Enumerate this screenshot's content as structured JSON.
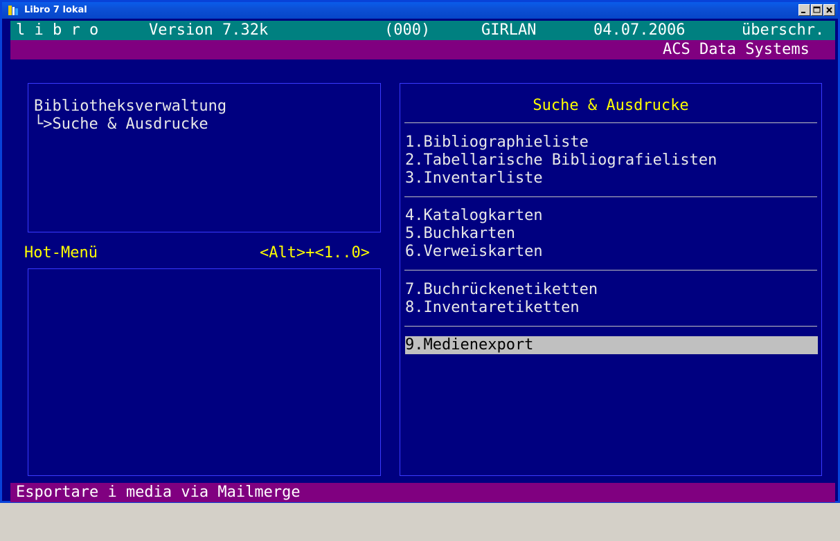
{
  "window": {
    "title": "Libro 7 lokal"
  },
  "status": {
    "app": "l i b r o",
    "version": "Version 7.32k",
    "code": "(000)",
    "site": "GIRLAN",
    "date": "04.07.2006",
    "mode": "überschr."
  },
  "company": "ACS Data Systems",
  "context": {
    "line1": "Bibliotheksverwaltung",
    "line2": "└>Suche & Ausdrucke"
  },
  "hotmenu": {
    "label": "Hot-Menü",
    "shortcut": "<Alt>+<1..0>"
  },
  "menu": {
    "title": "Suche & Ausdrucke",
    "items": [
      "1.Bibliographieliste",
      "2.Tabellarische Bibliografielisten",
      "3.Inventarliste",
      "4.Katalogkarten",
      "5.Buchkarten",
      "6.Verweiskarten",
      "7.Buchrückenetiketten",
      "8.Inventaretiketten",
      "9.Medienexport"
    ],
    "selected_index": 8
  },
  "footer": "Esportare i media via Mailmerge",
  "colors": {
    "background": "#000080",
    "status_bar": "#008080",
    "accent_bar": "#800080",
    "highlight": "#ffff00",
    "selection": "#c0c0c0"
  }
}
